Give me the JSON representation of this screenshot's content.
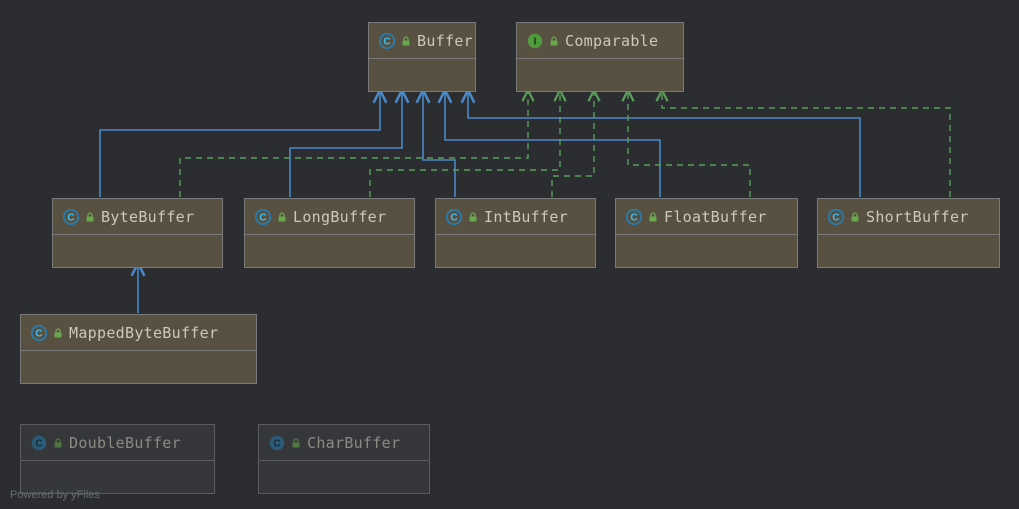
{
  "diagram": {
    "nodes": {
      "buffer": {
        "label": "Buffer",
        "kind": "class",
        "abstract": true
      },
      "comparable": {
        "label": "Comparable",
        "kind": "interface",
        "abstract": false
      },
      "bytebuffer": {
        "label": "ByteBuffer",
        "kind": "class",
        "abstract": true
      },
      "longbuffer": {
        "label": "LongBuffer",
        "kind": "class",
        "abstract": true
      },
      "intbuffer": {
        "label": "IntBuffer",
        "kind": "class",
        "abstract": true
      },
      "floatbuffer": {
        "label": "FloatBuffer",
        "kind": "class",
        "abstract": true
      },
      "shortbuffer": {
        "label": "ShortBuffer",
        "kind": "class",
        "abstract": true
      },
      "mappedbytebuffer": {
        "label": "MappedByteBuffer",
        "kind": "class",
        "abstract": true
      },
      "doublebuffer": {
        "label": "DoubleBuffer",
        "kind": "class",
        "abstract": false
      },
      "charbuffer": {
        "label": "CharBuffer",
        "kind": "class",
        "abstract": false
      }
    },
    "watermark": "Powered by yFiles"
  }
}
